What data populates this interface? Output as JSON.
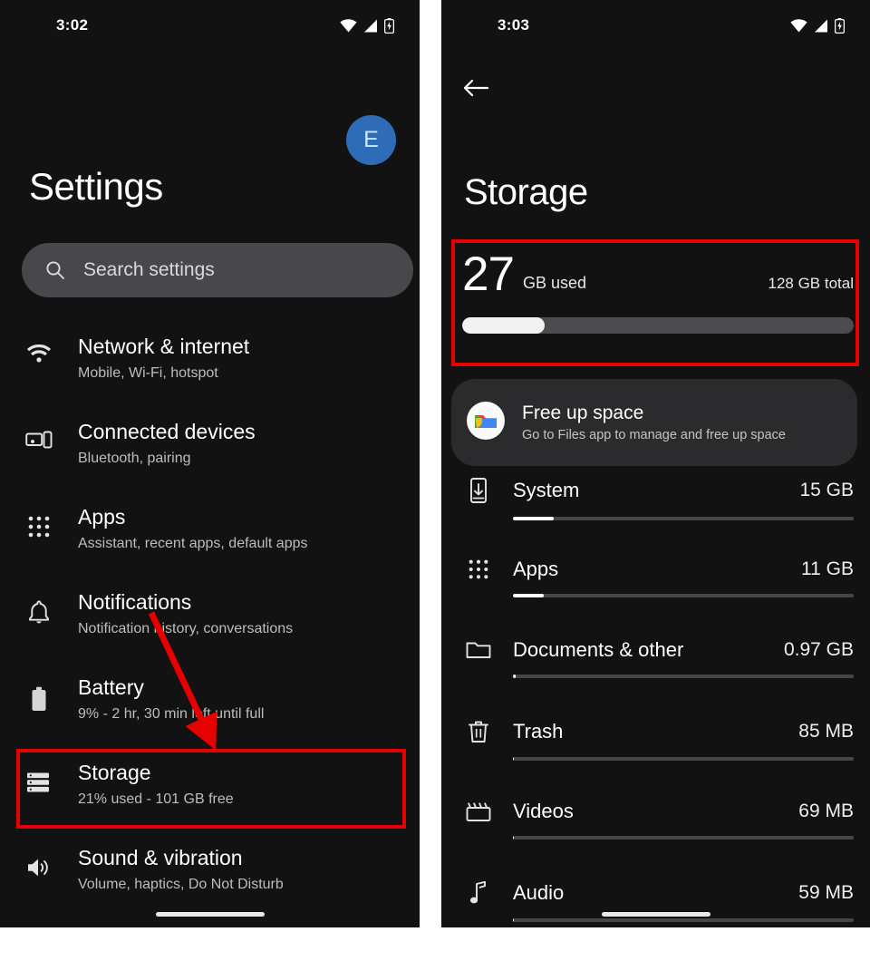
{
  "left_phone": {
    "status_bar": {
      "time": "3:02",
      "icons": [
        "wifi-icon",
        "cellular-signal-icon",
        "battery-charging-icon"
      ]
    },
    "avatar": {
      "initial": "E",
      "color": "#2e6cb8"
    },
    "title": "Settings",
    "search": {
      "placeholder": "Search settings",
      "icon": "search-icon"
    },
    "items": [
      {
        "icon": "wifi-icon",
        "title": "Network & internet",
        "subtitle": "Mobile, Wi-Fi, hotspot"
      },
      {
        "icon": "connected-devices-icon",
        "title": "Connected devices",
        "subtitle": "Bluetooth, pairing"
      },
      {
        "icon": "apps-grid-icon",
        "title": "Apps",
        "subtitle": "Assistant, recent apps, default apps"
      },
      {
        "icon": "bell-icon",
        "title": "Notifications",
        "subtitle": "Notification history, conversations"
      },
      {
        "icon": "battery-icon",
        "title": "Battery",
        "subtitle": "9% - 2 hr, 30 min left until full"
      },
      {
        "icon": "storage-icon",
        "title": "Storage",
        "subtitle": "21% used - 101 GB free"
      },
      {
        "icon": "volume-icon",
        "title": "Sound & vibration",
        "subtitle": "Volume, haptics, Do Not Disturb"
      }
    ]
  },
  "right_phone": {
    "status_bar": {
      "time": "3:03",
      "icons": [
        "wifi-icon",
        "cellular-signal-icon",
        "battery-charging-icon"
      ]
    },
    "back_icon": "back-arrow-icon",
    "title": "Storage",
    "summary": {
      "used_number": "27",
      "used_unit": "GB used",
      "total": "128 GB total",
      "fill_percent": 21
    },
    "free_up_space": {
      "icon": "files-app-icon",
      "title": "Free up space",
      "subtitle": "Go to Files app to manage and free up space"
    },
    "categories": [
      {
        "icon": "phone-download-icon",
        "name": "System",
        "value": "15 GB",
        "fill_percent": 12
      },
      {
        "icon": "apps-grid-icon",
        "name": "Apps",
        "value": "11 GB",
        "fill_percent": 9
      },
      {
        "icon": "folder-icon",
        "name": "Documents & other",
        "value": "0.97 GB",
        "fill_percent": 0.8
      },
      {
        "icon": "trash-icon",
        "name": "Trash",
        "value": "85 MB",
        "fill_percent": 0.2
      },
      {
        "icon": "movie-icon",
        "name": "Videos",
        "value": "69 MB",
        "fill_percent": 0.15
      },
      {
        "icon": "music-note-icon",
        "name": "Audio",
        "value": "59 MB",
        "fill_percent": 0.1
      }
    ]
  },
  "annotations": {
    "color": "#e60000",
    "highlight_boxes": [
      "storage-settings-item",
      "storage-summary"
    ],
    "arrow": "points from Notifications area down to Storage item"
  }
}
